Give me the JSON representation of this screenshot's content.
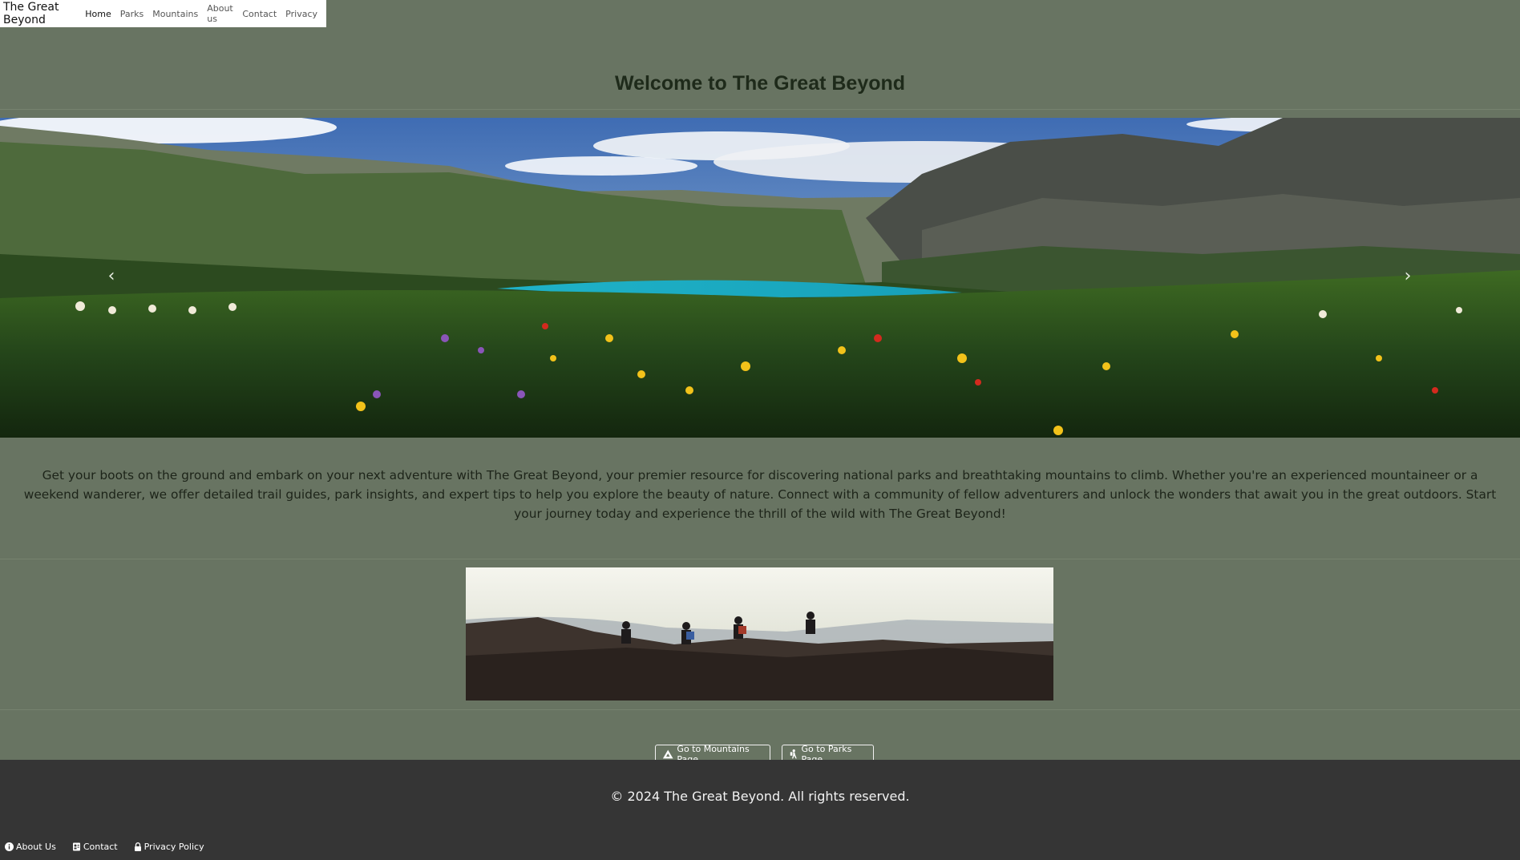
{
  "navbar": {
    "brand": "The Great Beyond",
    "links": [
      {
        "label": "Home"
      },
      {
        "label": "Parks"
      },
      {
        "label": "Mountains"
      },
      {
        "label": "About us"
      },
      {
        "label": "Contact"
      },
      {
        "label": "Privacy"
      }
    ]
  },
  "page": {
    "title": "Welcome to The Great Beyond",
    "intro": "Get your boots on the ground and embark on your next adventure with The Great Beyond, your premier resource for discovering national parks and breathtaking mountains to climb. Whether you're an experienced mountaineer or a weekend wanderer, we offer detailed trail guides, park insights, and expert tips to help you explore the beauty of nature. Connect with a community of fellow adventurers and unlock the wonders that await you in the great outdoors. Start your journey today and experience the thrill of the wild with The Great Beyond!"
  },
  "carousel": {
    "prev_icon": "chevron-left-icon",
    "next_icon": "chevron-right-icon"
  },
  "buttons": {
    "mountains": {
      "label": "Go to Mountains Page",
      "icon": "mountain-icon"
    },
    "parks": {
      "label": "Go to Parks Page",
      "icon": "hiker-icon"
    }
  },
  "footer": {
    "copyright": "© 2024 The Great Beyond. All rights reserved.",
    "links": [
      {
        "label": "About Us",
        "icon": "info-icon"
      },
      {
        "label": "Contact",
        "icon": "contact-card-icon"
      },
      {
        "label": "Privacy Policy",
        "icon": "lock-icon"
      }
    ]
  },
  "colors": {
    "background": "#687462",
    "footer": "#353535",
    "title": "#1e2a1a"
  }
}
